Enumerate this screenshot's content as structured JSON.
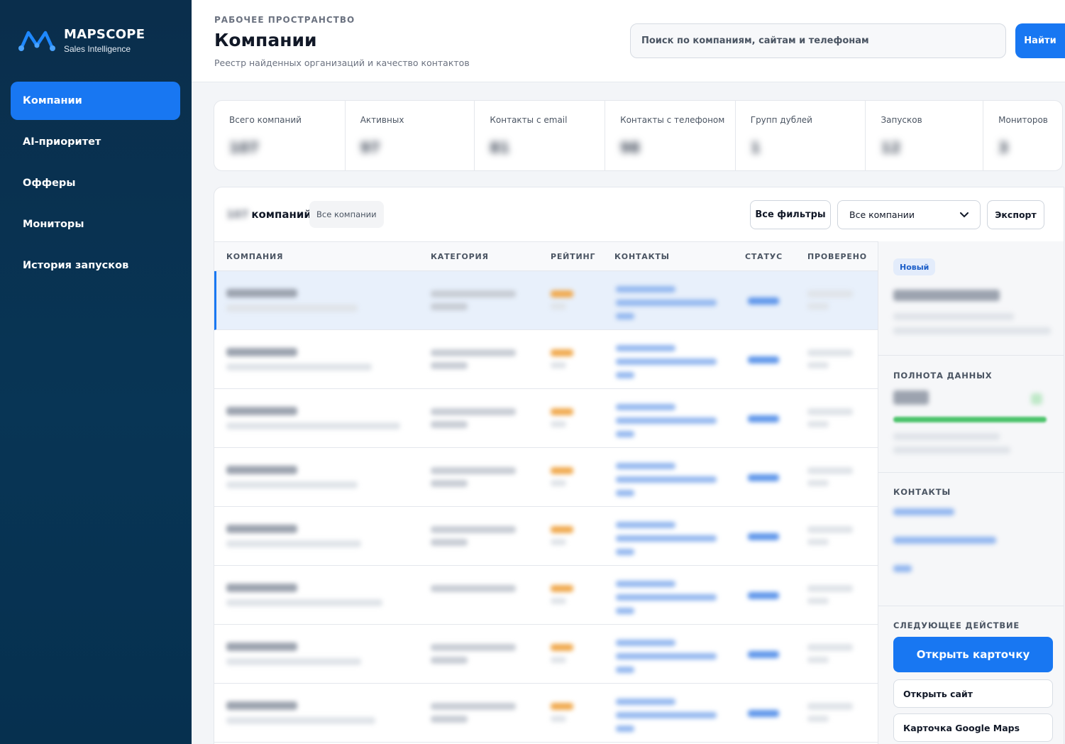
{
  "brand": {
    "name": "MAPSCOPE",
    "subtitle": "Sales Intelligence",
    "logo_icon": "m-wave-logo-icon",
    "accent": "#1877f2"
  },
  "sidebar": {
    "items": [
      {
        "label": "Компании",
        "active": true
      },
      {
        "label": "AI-приоритет"
      },
      {
        "label": "Офферы"
      },
      {
        "label": "Мониторы"
      },
      {
        "label": "История запусков"
      }
    ]
  },
  "header": {
    "eyebrow": "РАБОЧЕЕ ПРОСТРАНСТВО",
    "title": "Компании",
    "subtitle": "Реестр найденных организаций и качество контактов",
    "search_placeholder": "Поиск по компаниям, сайтам и телефонам",
    "search_button": "Найти"
  },
  "stats": [
    {
      "label": "Всего компаний",
      "value": "107"
    },
    {
      "label": "Активных",
      "value": "97"
    },
    {
      "label": "Контакты с email",
      "value": "81"
    },
    {
      "label": "Контакты с телефоном",
      "value": "98"
    },
    {
      "label": "Групп дублей",
      "value": "1"
    },
    {
      "label": "Запусков",
      "value": "12"
    },
    {
      "label": "Мониторов",
      "value": "3"
    }
  ],
  "companies": {
    "count": "107",
    "count_suffix": "компаний",
    "scope_pill": "Все компании",
    "filters_button": "Все фильтры",
    "scope_select": "Все компании",
    "export_button": "Экспорт",
    "columns": [
      "КОМПАНИЯ",
      "КАТЕГОРИЯ",
      "РЕЙТИНГ",
      "КОНТАКТЫ",
      "СТАТУС",
      "ПРОВЕРЕНО"
    ],
    "row_count": 8,
    "selected_row": 0
  },
  "detail": {
    "badge": "Новый",
    "completeness_title": "ПОЛНОТА ДАННЫХ",
    "completeness": 1.0,
    "contacts_title": "КОНТАКТЫ",
    "next_action_title": "СЛЕДУЮЩЕЕ ДЕЙСТВИЕ",
    "primary_button": "Открыть карточку",
    "site_button": "Открыть сайт",
    "maps_button": "Карточка Google Maps"
  }
}
